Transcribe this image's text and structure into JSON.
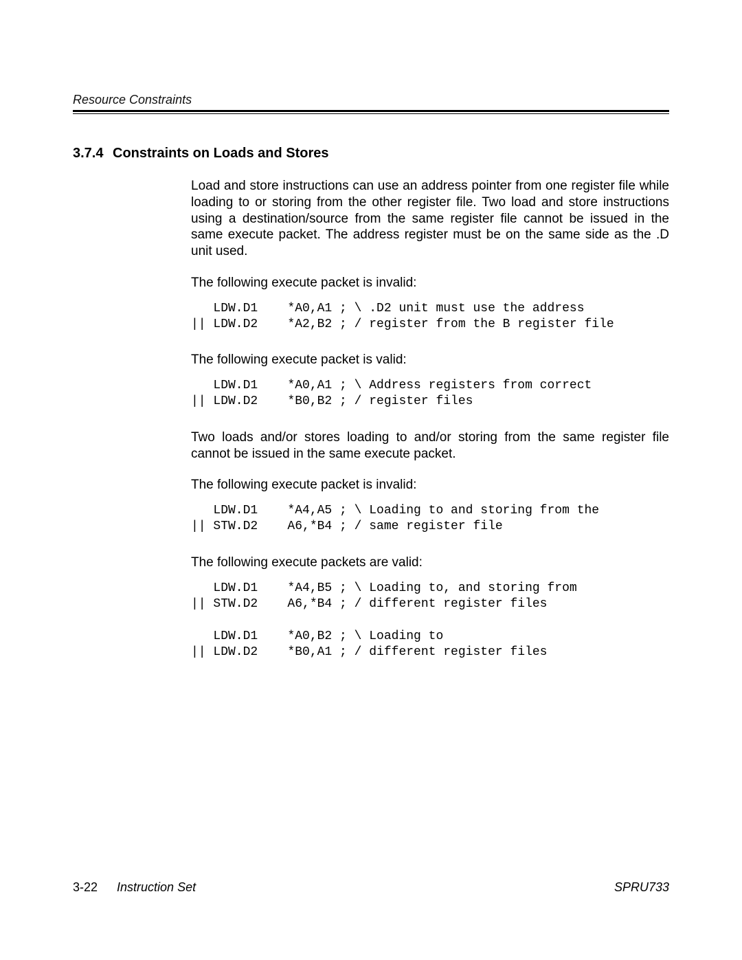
{
  "header": {
    "running_head": "Resource Constraints"
  },
  "section": {
    "number": "3.7.4",
    "title": "Constraints on Loads and Stores"
  },
  "body": {
    "p1": "Load and store instructions can use an address pointer from one register file while loading to or storing from the other register file. Two load and store instructions using a destination/source from the same register file cannot be issued in the same execute packet. The address register must be on the same side as the .D unit used.",
    "p2": "The following execute packet is invalid:",
    "code1": "   LDW.D1    *A0,A1 ; \\ .D2 unit must use the address\n|| LDW.D2    *A2,B2 ; / register from the B register file",
    "p3": "The following execute packet is valid:",
    "code2": "   LDW.D1    *A0,A1 ; \\ Address registers from correct\n|| LDW.D2    *B0,B2 ; / register files",
    "p4": "Two loads and/or stores loading to and/or storing from the same register file cannot be issued in the same execute packet.",
    "p5": "The following execute packet is invalid:",
    "code3": "   LDW.D1    *A4,A5 ; \\ Loading to and storing from the\n|| STW.D2    A6,*B4 ; / same register file",
    "p6": "The following execute packets are valid:",
    "code4": "   LDW.D1    *A4,B5 ; \\ Loading to, and storing from\n|| STW.D2    A6,*B4 ; / different register files\n\n   LDW.D1    *A0,B2 ; \\ Loading to\n|| LDW.D2    *B0,A1 ; / different register files"
  },
  "footer": {
    "page_number": "3-22",
    "chapter": "Instruction Set",
    "doc_id": "SPRU733"
  }
}
